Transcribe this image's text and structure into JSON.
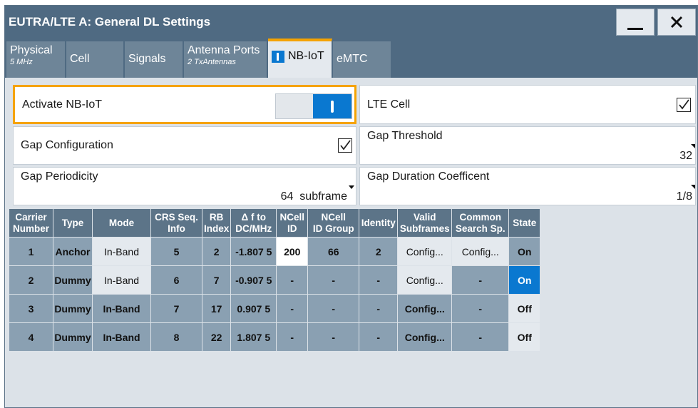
{
  "window": {
    "title": "EUTRA/LTE A: General DL Settings",
    "minimize_icon": "minimize-icon",
    "close_icon": "close-icon"
  },
  "tabs": [
    {
      "label": "Physical",
      "sub": "5 MHz"
    },
    {
      "label": "Cell",
      "sub": ""
    },
    {
      "label": "Signals",
      "sub": ""
    },
    {
      "label": "Antenna Ports",
      "sub": "2 TxAntennas"
    },
    {
      "label": "NB-IoT",
      "sub": "",
      "active": true
    },
    {
      "label": "eMTC",
      "sub": ""
    }
  ],
  "settings": {
    "activate_nbiot": {
      "label": "Activate NB-IoT",
      "state": "on"
    },
    "lte_cell": {
      "label": "LTE Cell",
      "checked": true
    },
    "gap_configuration": {
      "label": "Gap Configuration",
      "checked": true
    },
    "gap_threshold": {
      "label": "Gap Threshold",
      "value": "32"
    },
    "gap_periodicity": {
      "label": "Gap Periodicity",
      "value": "64  subframe"
    },
    "gap_duration": {
      "label": "Gap Duration Coefficent",
      "value": "1/8"
    }
  },
  "table": {
    "headers": [
      [
        "Carrier",
        "Number"
      ],
      [
        "Type"
      ],
      [
        "Mode"
      ],
      [
        "CRS Seq.",
        "Info"
      ],
      [
        "RB",
        "Index"
      ],
      [
        "Δ f to",
        "DC/MHz"
      ],
      [
        "NCell",
        "ID"
      ],
      [
        "NCell",
        "ID Group"
      ],
      [
        "Identity"
      ],
      [
        "Valid",
        "Subframes"
      ],
      [
        "Common",
        "Search Sp."
      ],
      [
        "State"
      ]
    ],
    "rows": [
      [
        "1",
        "Anchor",
        "In-Band",
        "5",
        "2",
        "-1.807 5",
        "200",
        "66",
        "2",
        "Config...",
        "Config...",
        "On"
      ],
      [
        "2",
        "Dummy",
        "In-Band",
        "6",
        "7",
        "-0.907 5",
        "-",
        "-",
        "-",
        "Config...",
        "-",
        "On"
      ],
      [
        "3",
        "Dummy",
        "In-Band",
        "7",
        "17",
        "0.907 5",
        "-",
        "-",
        "-",
        "Config...",
        "-",
        "Off"
      ],
      [
        "4",
        "Dummy",
        "In-Band",
        "8",
        "22",
        "1.807 5",
        "-",
        "-",
        "-",
        "Config...",
        "-",
        "Off"
      ]
    ]
  },
  "colors": {
    "titlebar": "#4f6a82",
    "accent_tab": "#f5a300",
    "selected": "#0a78d0"
  }
}
